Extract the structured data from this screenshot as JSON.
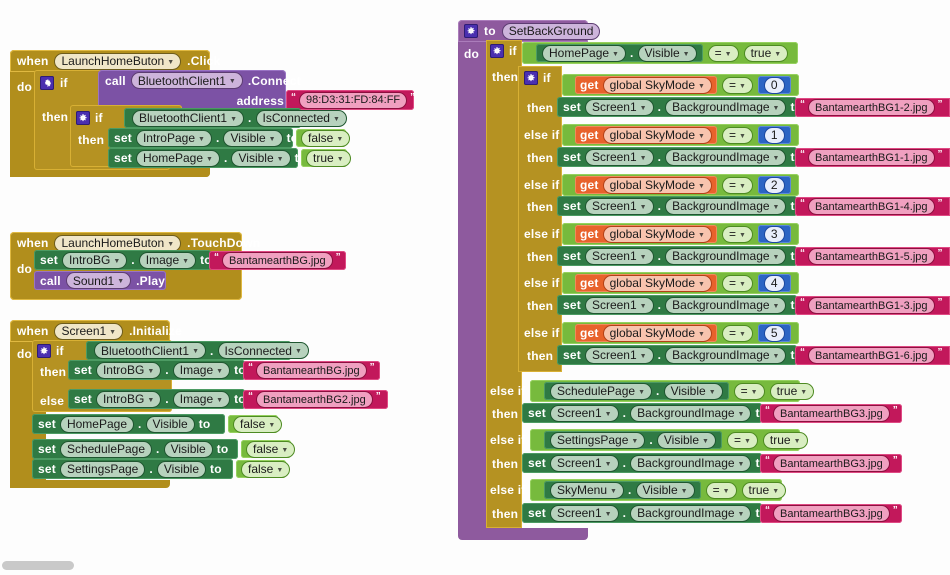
{
  "workspace": {
    "grid_color": "#e2e2e2",
    "background": "#fdfdfd"
  },
  "colors": {
    "event_gold": "#b18e1c",
    "control_gold": "#b59222",
    "component_green": "#2f7a44",
    "logic_light_green": "#77ba3d",
    "text_magenta": "#c2185b",
    "procedure_purple": "#8e5a9e",
    "method_call_purple": "#7c52a5",
    "variable_orange": "#e8622c",
    "math_blue": "#2b64c4"
  },
  "labels": {
    "when": "when",
    "do": "do",
    "if": "if",
    "then": "then",
    "else": "else",
    "else_if": "else if",
    "to": "to",
    "set": "set",
    "call": "call",
    "get": "get",
    "dot": ".",
    "address": "address",
    "equals": "=",
    "proc_to": "to"
  },
  "block1": {
    "event_component": "LaunchHomeButon",
    "event_name": ".Click",
    "call_component": "BluetoothClient1",
    "call_method": ".Connect",
    "address_label": "address",
    "address_value": "98:D3:31:FD:84:FF",
    "cond_component": "BluetoothClient1",
    "cond_property": "IsConnected",
    "set1_component": "IntroPage",
    "set1_property": "Visible",
    "set1_value": "false",
    "set2_component": "HomePage",
    "set2_property": "Visible",
    "set2_value": "true"
  },
  "block2": {
    "event_component": "LaunchHomeButon",
    "event_name": ".TouchDown",
    "set_component": "IntroBG",
    "set_property": "Image",
    "set_value": "BantamearthBG.jpg",
    "call_component": "Sound1",
    "call_method": ".Play"
  },
  "block3": {
    "event_component": "Screen1",
    "event_name": ".Initialize",
    "cond_component": "BluetoothClient1",
    "cond_property": "IsConnected",
    "then_component": "IntroBG",
    "then_property": "Image",
    "then_value": "BantamearthBG.jpg",
    "else_component": "IntroBG",
    "else_property": "Image",
    "else_value": "BantamearthBG2.jpg",
    "sets": [
      {
        "component": "HomePage",
        "property": "Visible",
        "value": "false"
      },
      {
        "component": "SchedulePage",
        "property": "Visible",
        "value": "false"
      },
      {
        "component": "SettingsPage",
        "property": "Visible",
        "value": "false"
      }
    ]
  },
  "procedure": {
    "name": "SetBackGround",
    "outer_if": {
      "component": "HomePage",
      "property": "Visible",
      "operator": "=",
      "value": "true"
    },
    "sky_branches": [
      {
        "variable": "global SkyMode",
        "operator": "=",
        "number": "0",
        "set_component": "Screen1",
        "set_property": "BackgroundImage",
        "image": "BantamearthBG1-2.jpg",
        "branch": "if"
      },
      {
        "variable": "global SkyMode",
        "operator": "=",
        "number": "1",
        "set_component": "Screen1",
        "set_property": "BackgroundImage",
        "image": "BantamearthBG1-1.jpg",
        "branch": "else if"
      },
      {
        "variable": "global SkyMode",
        "operator": "=",
        "number": "2",
        "set_component": "Screen1",
        "set_property": "BackgroundImage",
        "image": "BantamearthBG1-4.jpg",
        "branch": "else if"
      },
      {
        "variable": "global SkyMode",
        "operator": "=",
        "number": "3",
        "set_component": "Screen1",
        "set_property": "BackgroundImage",
        "image": "BantamearthBG1-5.jpg",
        "branch": "else if"
      },
      {
        "variable": "global SkyMode",
        "operator": "=",
        "number": "4",
        "set_component": "Screen1",
        "set_property": "BackgroundImage",
        "image": "BantamearthBG1-3.jpg",
        "branch": "else if"
      },
      {
        "variable": "global SkyMode",
        "operator": "=",
        "number": "5",
        "set_component": "Screen1",
        "set_property": "BackgroundImage",
        "image": "BantamearthBG1-6.jpg",
        "branch": "else if"
      }
    ],
    "page_branches": [
      {
        "component": "SchedulePage",
        "property": "Visible",
        "operator": "=",
        "value": "true",
        "set_component": "Screen1",
        "set_property": "BackgroundImage",
        "image": "BantamearthBG3.jpg"
      },
      {
        "component": "SettingsPage",
        "property": "Visible",
        "operator": "=",
        "value": "true",
        "set_component": "Screen1",
        "set_property": "BackgroundImage",
        "image": "BantamearthBG3.jpg"
      },
      {
        "component": "SkyMenu",
        "property": "Visible",
        "operator": "=",
        "value": "true",
        "set_component": "Screen1",
        "set_property": "BackgroundImage",
        "image": "BantamearthBG3.jpg"
      }
    ]
  }
}
